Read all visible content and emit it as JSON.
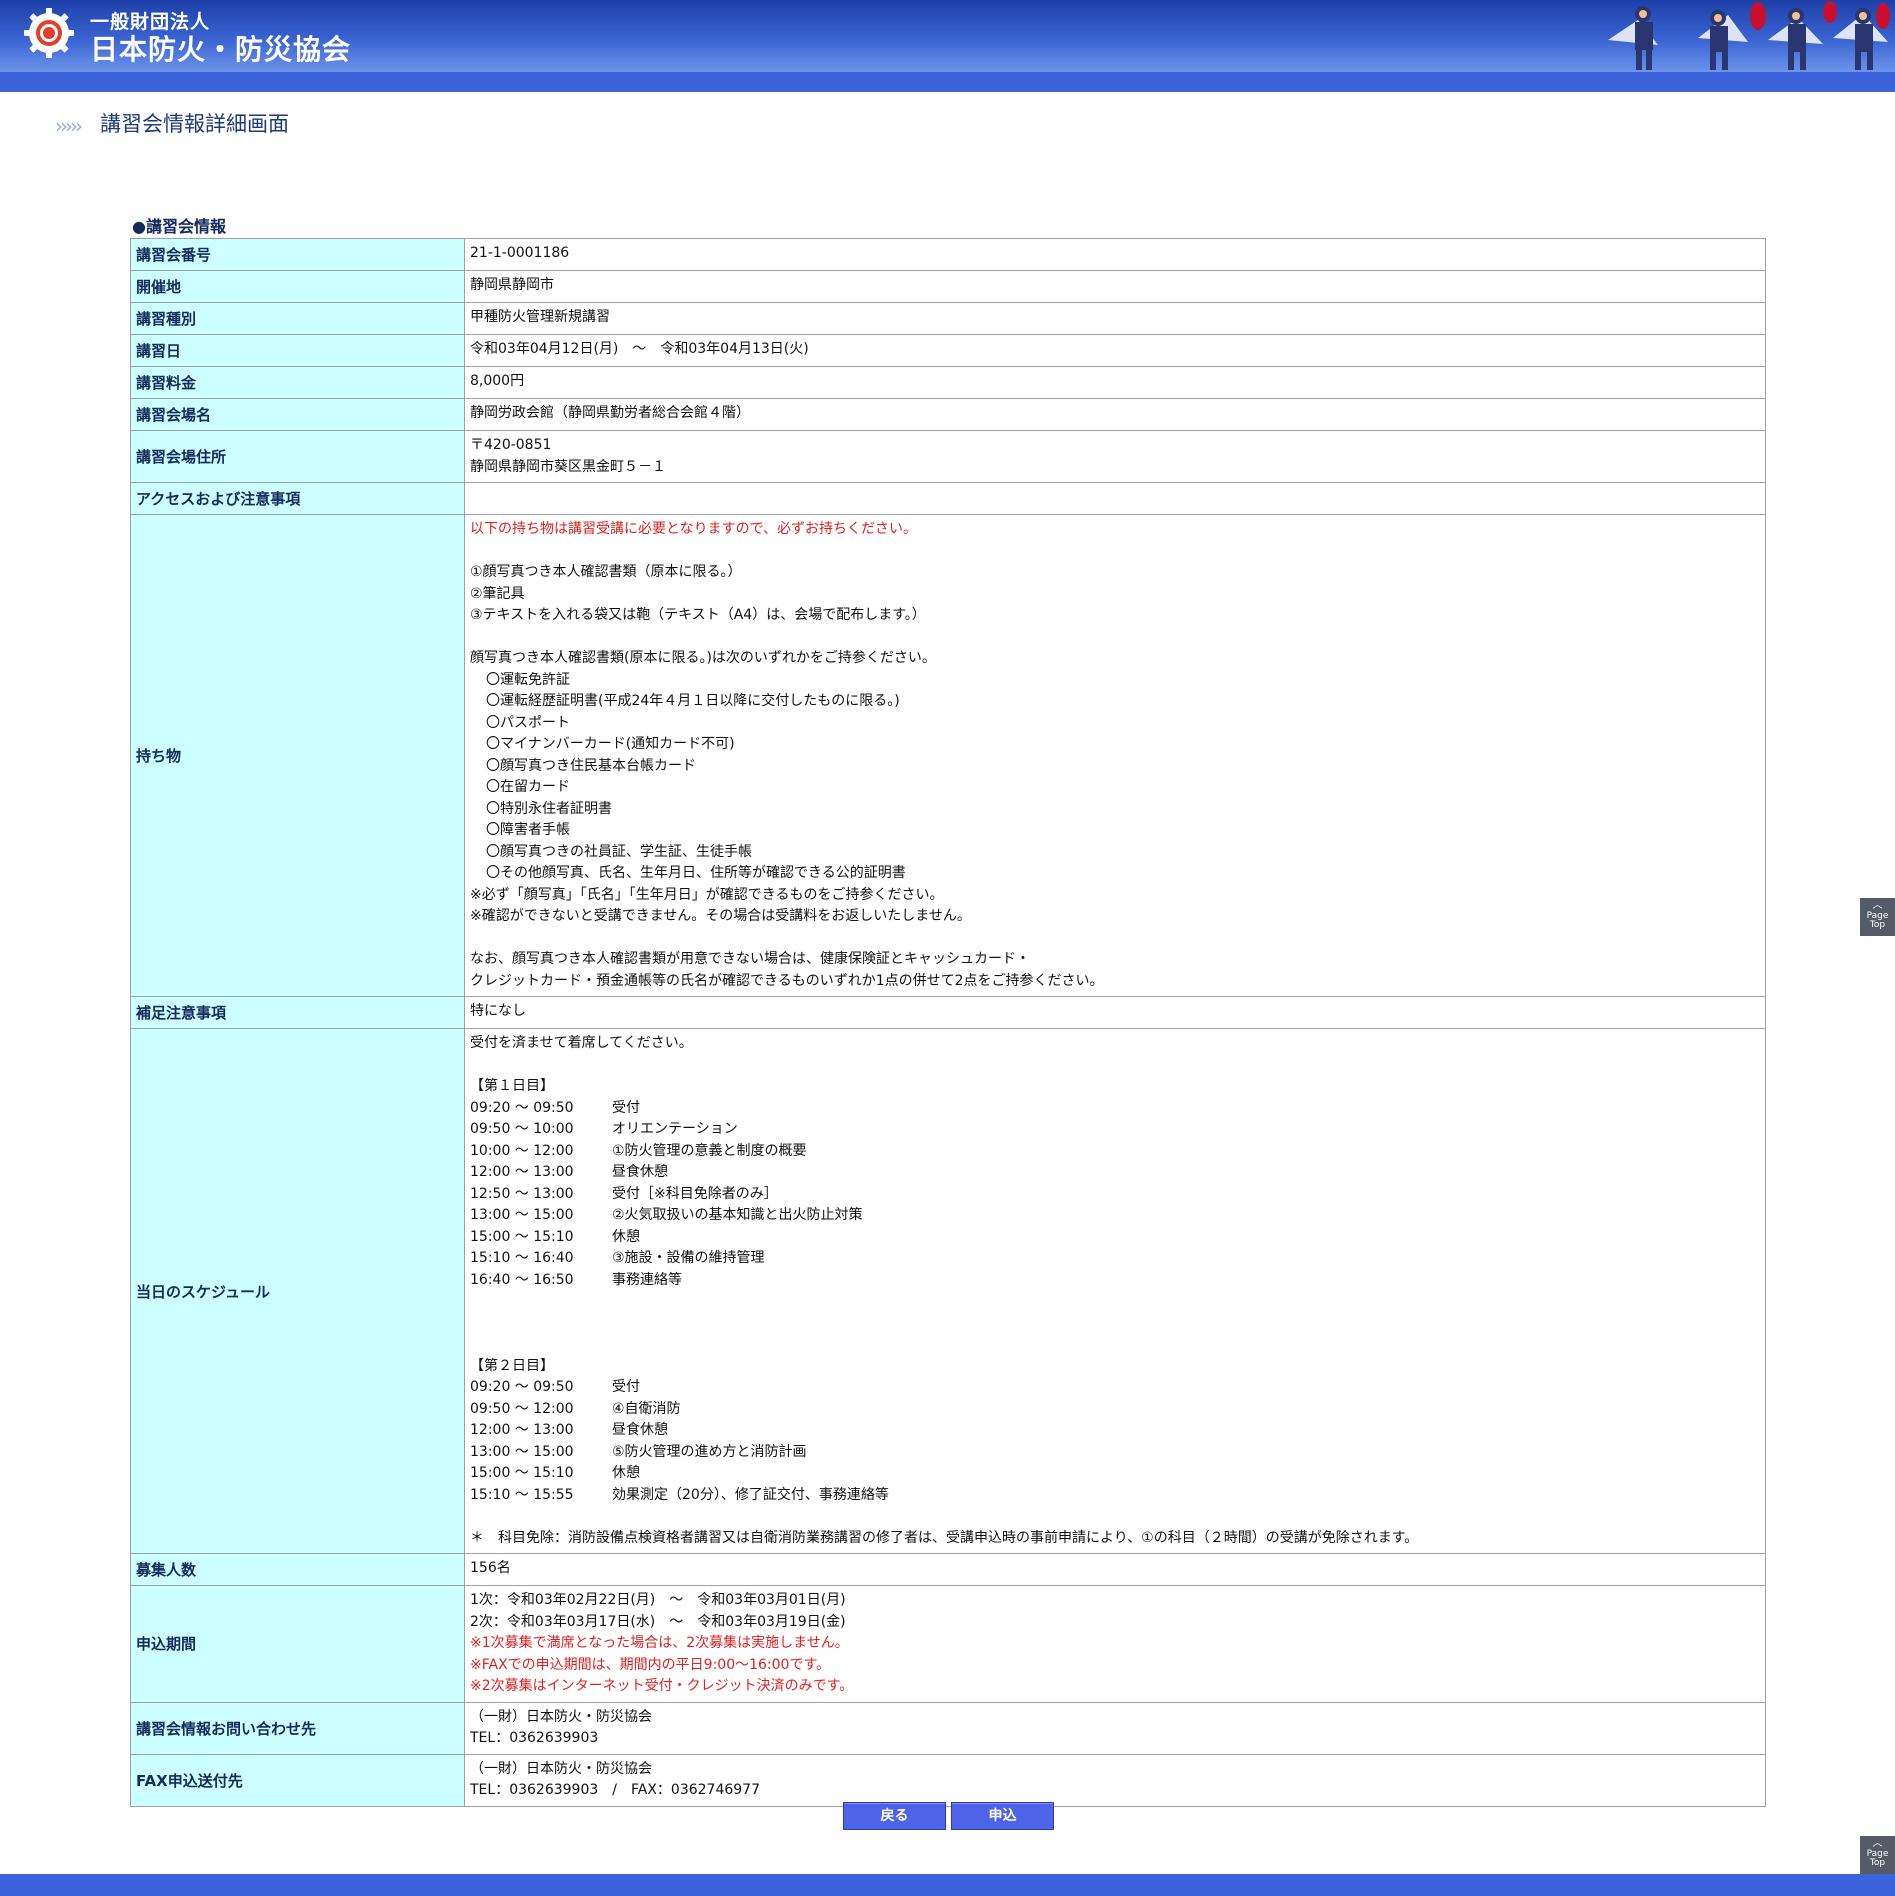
{
  "header": {
    "org_type": "一般財団法人",
    "org_name": "日本防火・防災協会"
  },
  "page_title": "講習会情報詳細画面",
  "section_heading": "●講習会情報",
  "rows": {
    "number": {
      "label": "講習会番号",
      "value": "21-1-0001186"
    },
    "location": {
      "label": "開催地",
      "value": "静岡県静岡市"
    },
    "type": {
      "label": "講習種別",
      "value": "甲種防火管理新規講習"
    },
    "dates": {
      "label": "講習日",
      "value": "令和03年04月12日(月)　～　令和03年04月13日(火)"
    },
    "fee": {
      "label": "講習料金",
      "value": "8,000円"
    },
    "venue": {
      "label": "講習会場名",
      "value": "静岡労政会館（静岡県勤労者総合会館４階）"
    },
    "address": {
      "label": "講習会場住所",
      "postal": "〒420-0851",
      "line": "静岡県静岡市葵区黒金町５－１"
    },
    "access": {
      "label": "アクセスおよび注意事項",
      "value": ""
    },
    "items": {
      "label": "持ち物",
      "notice": "以下の持ち物は講習受講に必要となりますので、必ずお持ちください。",
      "list": [
        "①顔写真つき本人確認書類（原本に限る。）",
        "②筆記具",
        "③テキストを入れる袋又は鞄（テキスト（A4）は、会場で配布します。）"
      ],
      "id_intro": "顔写真つき本人確認書類(原本に限る。)は次のいずれかをご持参ください。",
      "id_list": [
        "〇運転免許証",
        "〇運転経歴証明書(平成24年４月１日以降に交付したものに限る。)",
        "〇パスポート",
        "〇マイナンバーカード(通知カード不可)",
        "〇顔写真つき住民基本台帳カード",
        "〇在留カード",
        "〇特別永住者証明書",
        "〇障害者手帳",
        "〇顔写真つきの社員証、学生証、生徒手帳",
        "〇その他顔写真、氏名、生年月日、住所等が確認できる公的証明書"
      ],
      "notes": [
        "※必ず「顔写真」「氏名」「生年月日」が確認できるものをご持参ください。",
        "※確認ができないと受講できません。その場合は受講料をお返しいたしません。"
      ],
      "alt": [
        "なお、顔写真つき本人確認書類が用意できない場合は、健康保険証とキャッシュカード・",
        "クレジットカード・預金通帳等の氏名が確認できるものいずれか1点の併せて2点をご持参ください。"
      ]
    },
    "supplement": {
      "label": "補足注意事項",
      "value": "特になし"
    },
    "schedule": {
      "label": "当日のスケジュール",
      "intro": "受付を済ませて着席してください。",
      "day1_title": "【第１日目】",
      "day1": [
        {
          "time": "09:20 ～ 09:50",
          "desc": "受付"
        },
        {
          "time": "09:50 ～ 10:00",
          "desc": "オリエンテーション"
        },
        {
          "time": "10:00 ～ 12:00",
          "desc": "①防火管理の意義と制度の概要"
        },
        {
          "time": "12:00 ～ 13:00",
          "desc": "昼食休憩"
        },
        {
          "time": "12:50 ～ 13:00",
          "desc": "受付［※科目免除者のみ］"
        },
        {
          "time": "13:00 ～ 15:00",
          "desc": "②火気取扱いの基本知識と出火防止対策"
        },
        {
          "time": "15:00 ～ 15:10",
          "desc": "休憩"
        },
        {
          "time": "15:10 ～ 16:40",
          "desc": "③施設・設備の維持管理"
        },
        {
          "time": "16:40 ～ 16:50",
          "desc": "事務連絡等"
        }
      ],
      "day2_title": "【第２日目】",
      "day2": [
        {
          "time": "09:20 ～ 09:50",
          "desc": "受付"
        },
        {
          "time": "09:50 ～ 12:00",
          "desc": "④自衛消防"
        },
        {
          "time": "12:00 ～ 13:00",
          "desc": "昼食休憩"
        },
        {
          "time": "13:00 ～ 15:00",
          "desc": "⑤防火管理の進め方と消防計画"
        },
        {
          "time": "15:00 ～ 15:10",
          "desc": "休憩"
        },
        {
          "time": "15:10 ～ 15:55",
          "desc": "効果測定（20分）、修了証交付、事務連絡等"
        }
      ],
      "exemption": "＊　科目免除：消防設備点検資格者講習又は自衛消防業務講習の修了者は、受講申込時の事前申請により、①の科目（２時間）の受講が免除されます。"
    },
    "capacity": {
      "label": "募集人数",
      "value": "156名"
    },
    "period": {
      "label": "申込期間",
      "first": "1次：令和03年02月22日(月)　～　令和03年03月01日(月)",
      "second": "2次：令和03年03月17日(水)　～　令和03年03月19日(金)",
      "notes": [
        "※1次募集で満席となった場合は、2次募集は実施しません。",
        "※FAXでの申込期間は、期間内の平日9:00～16:00です。",
        "※2次募集はインターネット受付・クレジット決済のみです。"
      ]
    },
    "contact": {
      "label": "講習会情報お問い合わせ先",
      "org": "（一財）日本防火・防災協会",
      "tel": "TEL：0362639903"
    },
    "fax": {
      "label": "FAX申込送付先",
      "org": "（一財）日本防火・防災協会",
      "telfax": "TEL：0362639903　/　FAX：0362746977"
    }
  },
  "buttons": {
    "back": "戻る",
    "apply": "申込"
  },
  "page_top": {
    "line1": "Page",
    "line2": "Top"
  },
  "colors": {
    "header": "#3a64d2",
    "label_bg": "#ccffff",
    "button": "#4f63e8",
    "notice_red": "#e02020"
  }
}
